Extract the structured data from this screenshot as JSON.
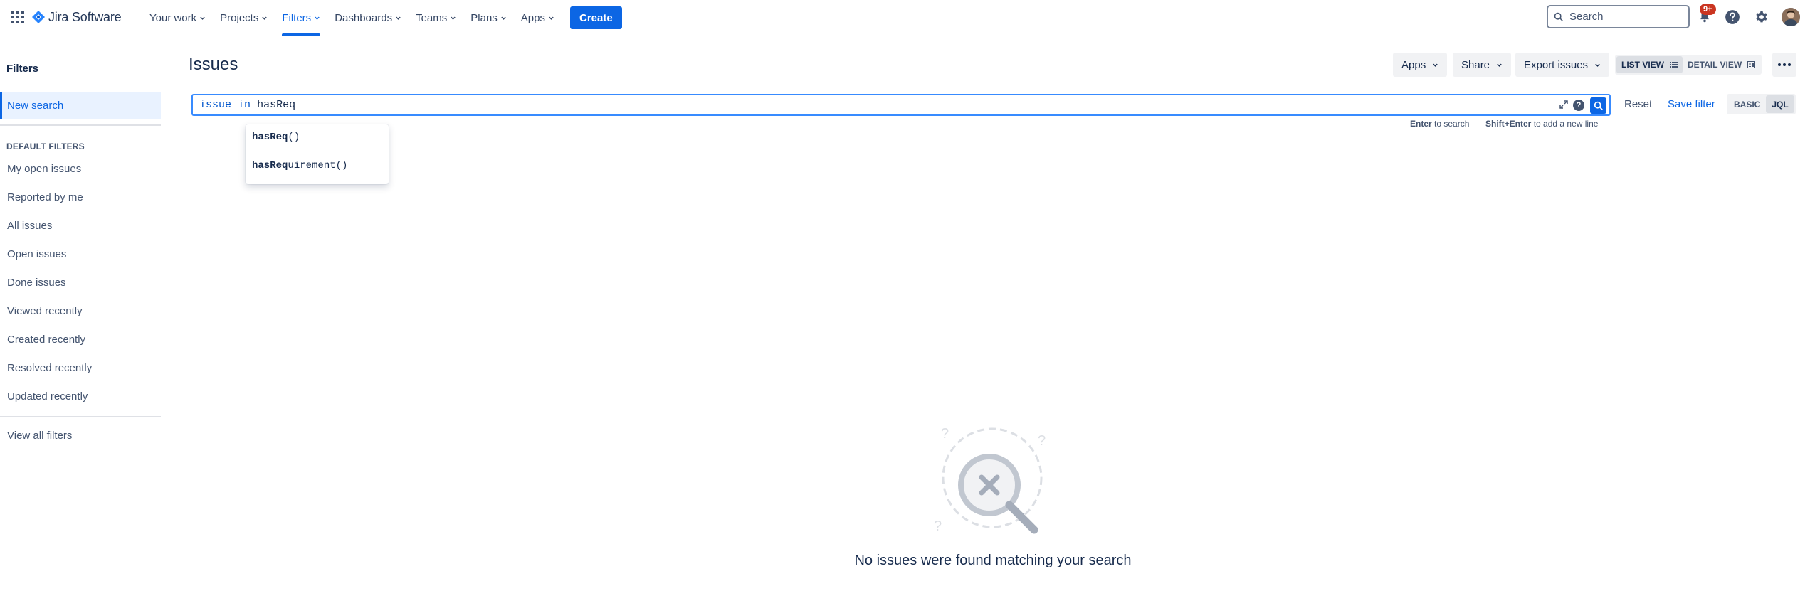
{
  "nav": {
    "brand": "Jira Software",
    "items": [
      {
        "label": "Your work"
      },
      {
        "label": "Projects"
      },
      {
        "label": "Filters"
      },
      {
        "label": "Dashboards"
      },
      {
        "label": "Teams"
      },
      {
        "label": "Plans"
      },
      {
        "label": "Apps"
      }
    ],
    "active_item": "Filters",
    "create_label": "Create",
    "search_placeholder": "Search",
    "notifications_badge": "9+",
    "accent_color": "#0c66e4"
  },
  "sidebar": {
    "title": "Filters",
    "new_search": "New search",
    "heading": "DEFAULT FILTERS",
    "links": [
      "My open issues",
      "Reported by me",
      "All issues",
      "Open issues",
      "Done issues",
      "Viewed recently",
      "Created recently",
      "Resolved recently",
      "Updated recently"
    ],
    "view_all": "View all filters"
  },
  "main": {
    "title": "Issues",
    "apps_label": "Apps",
    "share_label": "Share",
    "export_label": "Export issues",
    "list_view_label": "LIST VIEW",
    "detail_view_label": "DETAIL VIEW",
    "active_view": "LIST VIEW",
    "jql": {
      "keyword": "issue",
      "operator": "in",
      "value": "hasReq",
      "hint_enter_key": "Enter",
      "hint_enter_text": "to search",
      "hint_shift_key": "Shift+Enter",
      "hint_shift_text": "to add a new line"
    },
    "reset_label": "Reset",
    "save_filter_label": "Save filter",
    "mode_basic": "BASIC",
    "mode_jql": "JQL",
    "active_mode": "JQL",
    "suggestions": [
      {
        "match": "hasReq",
        "rest": "()"
      },
      {
        "match": "hasReq",
        "rest": "uirement()"
      }
    ],
    "empty_message": "No issues were found matching your search"
  }
}
